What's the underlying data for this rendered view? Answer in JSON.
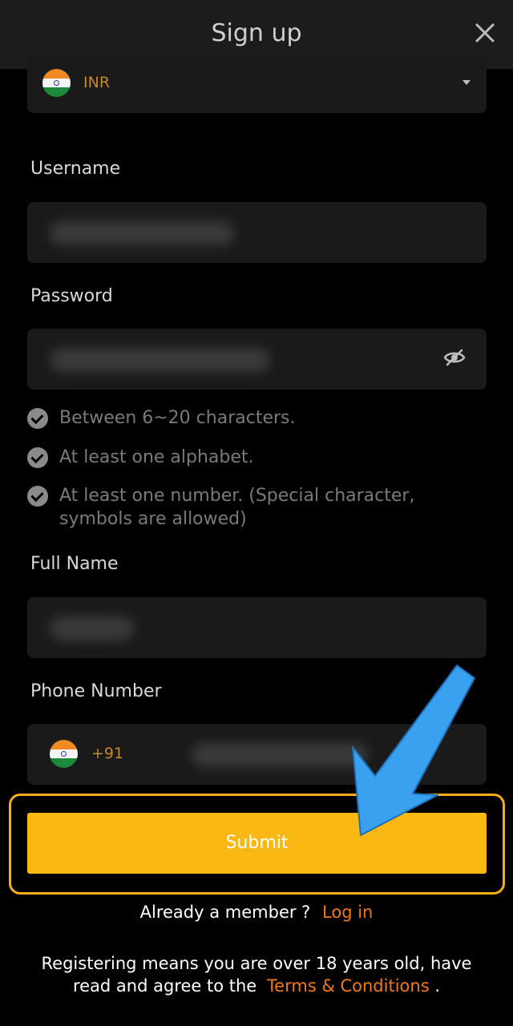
{
  "header": {
    "title": "Sign up"
  },
  "currency": {
    "code": "INR"
  },
  "username": {
    "label": "Username"
  },
  "password": {
    "label": "Password"
  },
  "rules": [
    "Between 6~20 characters.",
    "At least one alphabet.",
    "At least one number. (Special character, symbols are allowed)"
  ],
  "full_name": {
    "label": "Full Name"
  },
  "phone": {
    "label": "Phone Number",
    "country_code": "+91"
  },
  "submit": {
    "label": "Submit"
  },
  "login": {
    "prompt": "Already a member ?",
    "link": "Log in"
  },
  "legal": {
    "text": "Registering means you are over 18 years old, have read and agree to the",
    "link": "Terms & Conditions",
    "end": "."
  },
  "colors": {
    "accent": "#fbb813",
    "link": "#f07a18",
    "arrow": "#3aa0f0"
  }
}
